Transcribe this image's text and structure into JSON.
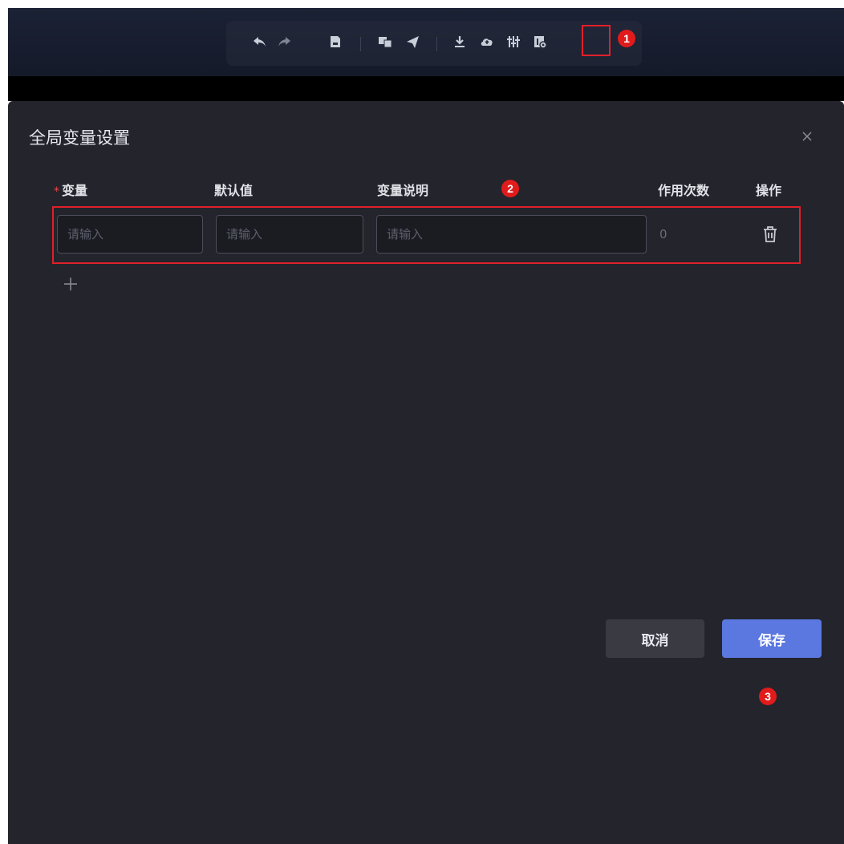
{
  "toolbar": {
    "icons": [
      "undo-icon",
      "redo-icon",
      "save-file-icon",
      "preview-icon",
      "publish-icon",
      "download-icon",
      "upload-cloud-icon",
      "adjust-icon",
      "global-variables-icon"
    ]
  },
  "markers": {
    "m1": "1",
    "m2": "2",
    "m3": "3"
  },
  "dialog": {
    "title": "全局变量设置",
    "columns": {
      "required_mark": "*",
      "variable": "变量",
      "default_value": "默认值",
      "description": "变量说明",
      "usage_count": "作用次数",
      "actions": "操作"
    },
    "row": {
      "variable_placeholder": "请输入",
      "default_placeholder": "请输入",
      "description_placeholder": "请输入",
      "usage_count": "0"
    },
    "buttons": {
      "cancel": "取消",
      "save": "保存"
    }
  },
  "colors": {
    "highlight": "#e0202a",
    "primary": "#5b78e0",
    "dialog_bg": "#24252c"
  }
}
